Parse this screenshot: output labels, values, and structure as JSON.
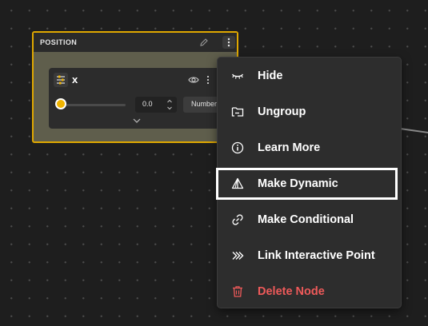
{
  "node": {
    "title": "POSITION",
    "variable": {
      "name": "x",
      "value": "0.0",
      "type": "Number",
      "slider_level": 0
    }
  },
  "menu": {
    "items": [
      {
        "label": "Hide",
        "icon": "eye-closed-icon"
      },
      {
        "label": "Ungroup",
        "icon": "ungroup-icon"
      },
      {
        "label": "Learn More",
        "icon": "info-icon"
      },
      {
        "label": "Make Dynamic",
        "icon": "dynamic-triangle-icon",
        "selected": true
      },
      {
        "label": "Make Conditional",
        "icon": "link-icon"
      },
      {
        "label": "Link Interactive Point",
        "icon": "double-chevron-right-icon"
      },
      {
        "label": "Delete Node",
        "icon": "trash-icon",
        "danger": true
      }
    ]
  },
  "colors": {
    "node_border": "#e0a800",
    "slider_thumb": "#f0b400",
    "danger": "#ef5a5a",
    "menu_bg": "#2d2d2d"
  }
}
